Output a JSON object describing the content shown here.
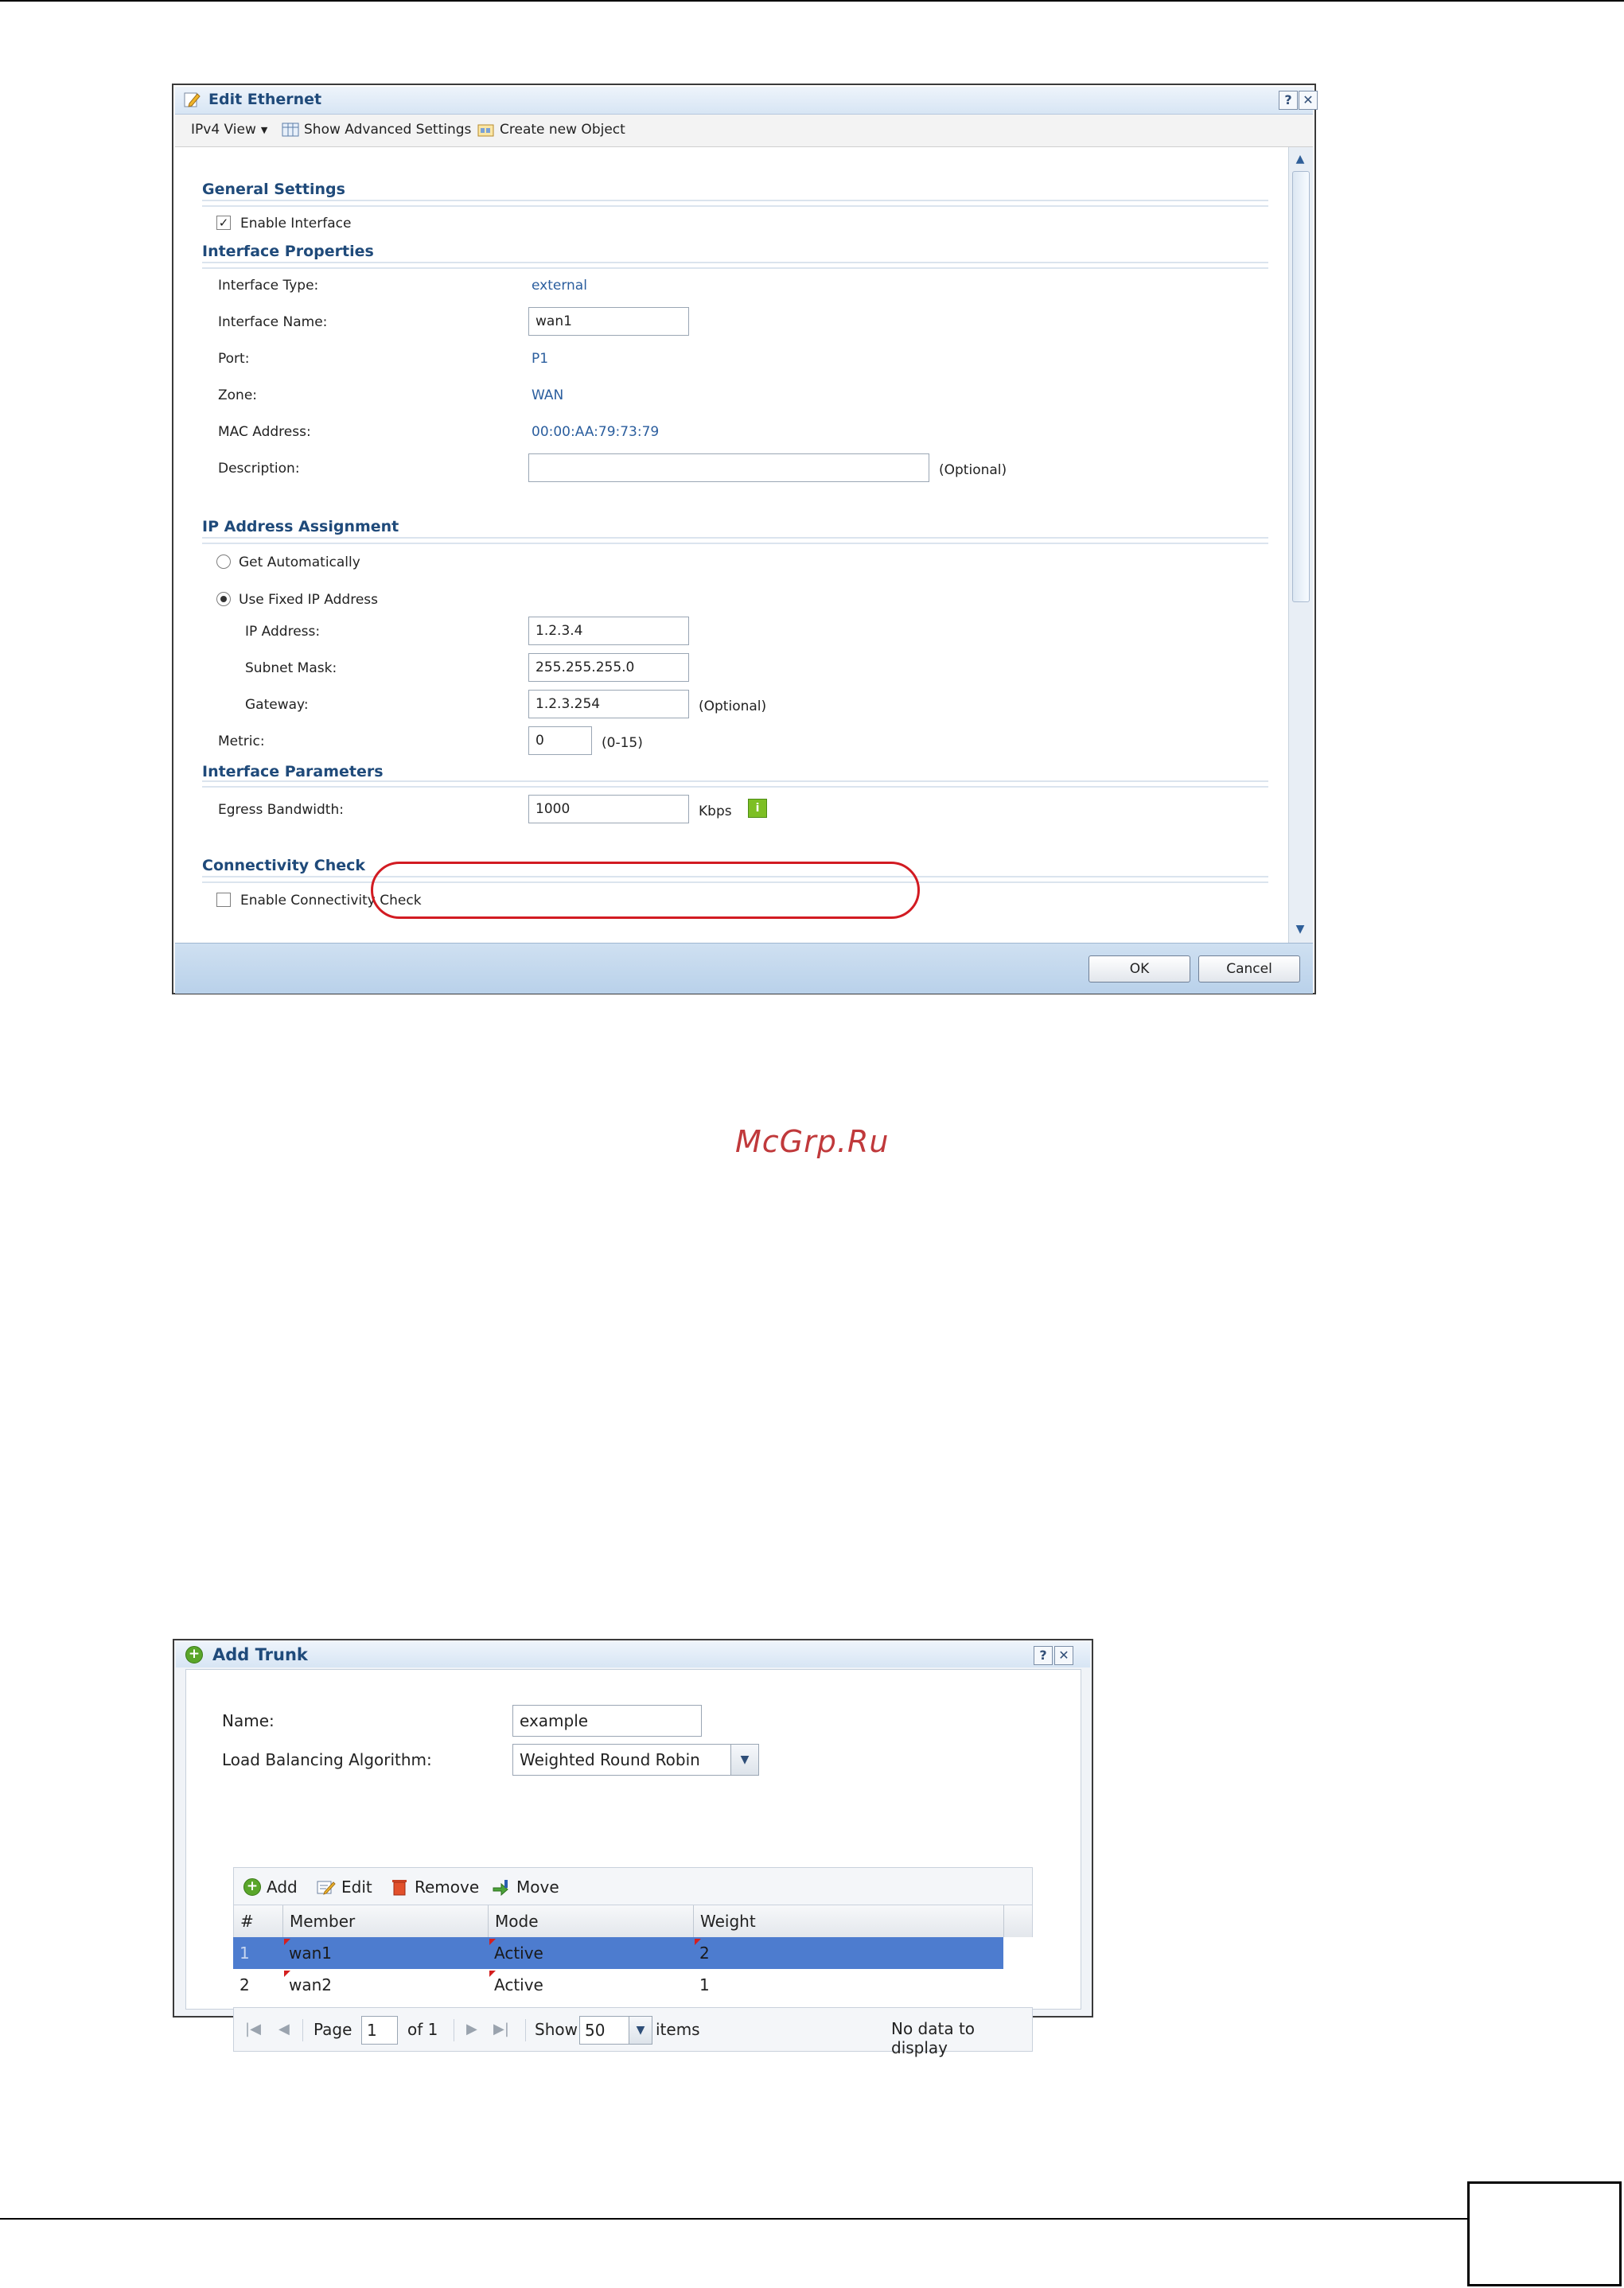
{
  "edit_ethernet": {
    "title": "Edit Ethernet",
    "help_label": "?",
    "close_label": "✕",
    "toolbar": {
      "view_label": "IPv4 View",
      "advanced_label": "Show Advanced Settings",
      "create_label": "Create new Object"
    },
    "general": {
      "heading": "General Settings",
      "enable_label": "Enable Interface",
      "enable_checked": true
    },
    "properties": {
      "heading": "Interface Properties",
      "type_label": "Interface Type:",
      "type_value": "external",
      "name_label": "Interface Name:",
      "name_value": "wan1",
      "port_label": "Port:",
      "port_value": "P1",
      "zone_label": "Zone:",
      "zone_value": "WAN",
      "mac_label": "MAC Address:",
      "mac_value": "00:00:AA:79:73:79",
      "desc_label": "Description:",
      "desc_value": "",
      "desc_hint": "(Optional)"
    },
    "ip_assignment": {
      "heading": "IP Address Assignment",
      "auto_label": "Get Automatically",
      "fixed_label": "Use Fixed IP Address",
      "ip_label": "IP Address:",
      "ip_value": "1.2.3.4",
      "mask_label": "Subnet Mask:",
      "mask_value": "255.255.255.0",
      "gateway_label": "Gateway:",
      "gateway_value": "1.2.3.254",
      "gateway_hint": "(Optional)",
      "metric_label": "Metric:",
      "metric_value": "0",
      "metric_hint": "(0-15)"
    },
    "parameters": {
      "heading": "Interface Parameters",
      "egress_label": "Egress Bandwidth:",
      "egress_value": "1000",
      "egress_unit": "Kbps"
    },
    "connectivity": {
      "heading": "Connectivity Check",
      "enable_label": "Enable Connectivity Check",
      "enable_checked": false
    },
    "buttons": {
      "ok": "OK",
      "cancel": "Cancel"
    }
  },
  "watermark": "McGrp.Ru",
  "add_trunk": {
    "title": "Add Trunk",
    "help_label": "?",
    "close_label": "✕",
    "name_label": "Name:",
    "name_value": "example",
    "algo_label": "Load Balancing Algorithm:",
    "algo_value": "Weighted Round Robin",
    "toolbar": {
      "add": "Add",
      "edit": "Edit",
      "remove": "Remove",
      "move": "Move"
    },
    "columns": [
      "#",
      "Member",
      "Mode",
      "Weight"
    ],
    "rows": [
      {
        "num": "1",
        "member": "wan1",
        "mode": "Active",
        "weight": "2",
        "selected": true
      },
      {
        "num": "2",
        "member": "wan2",
        "mode": "Active",
        "weight": "1",
        "selected": false
      }
    ],
    "pager": {
      "page_label": "Page",
      "page_value": "1",
      "of_label": "of 1",
      "show_label": "Show",
      "show_value": "50",
      "items_label": "items",
      "status": "No data to display"
    }
  },
  "colors": {
    "title_blue": "#1f4a7a",
    "link_blue": "#2b5e9e",
    "highlight_red": "#d21b22",
    "selected_row": "#4d7ccf"
  }
}
